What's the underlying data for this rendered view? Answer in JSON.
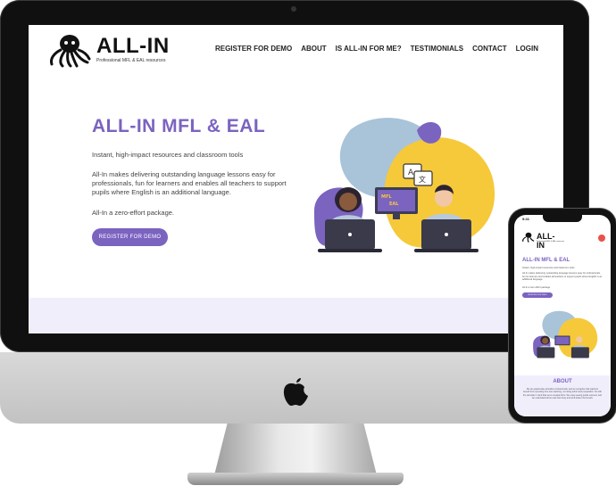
{
  "site": {
    "logo_text": "ALL-IN",
    "logo_sub": "Professional MFL & EAL resources",
    "nav": [
      {
        "label": "REGISTER FOR DEMO"
      },
      {
        "label": "ABOUT"
      },
      {
        "label": "IS ALL-IN FOR ME?"
      },
      {
        "label": "TESTIMONIALS"
      },
      {
        "label": "CONTACT"
      },
      {
        "label": "LOGIN"
      }
    ],
    "hero": {
      "title": "ALL-IN MFL & EAL",
      "p1": "Instant, high-impact resources and classroom tools",
      "p2": "All-In makes delivering outstanding language lessons easy for professionals, fun for learners and enables all teachers to support pupils where English is an additional language.",
      "p3": "All-In a zero-effort package.",
      "button": "REGISTER FOR DEMO"
    },
    "illustration": {
      "screen_text_1": "MFL",
      "screen_text_2": "EAL"
    }
  },
  "phone": {
    "time": "9:41",
    "logo_text": "ALL-IN",
    "logo_sub": "Professional MFL & EAL resources",
    "title": "ALL-IN MFL & EAL",
    "p1": "Instant, high-impact resources and classroom tools",
    "p2": "All-In makes delivering outstanding language lessons easy for professionals, fun for learners and enables all teachers to support pupils where English is an additional language.",
    "p3": "All-In a zero-effort package.",
    "button": "REGISTER FOR DEMO",
    "about_title": "ABOUT",
    "about_text": "We are passionate education professionals, and we recognise that teachers benefit from spending time less teaching, not doing admin and preparation. So with the principle in mind that we've created All-In. We enjoy seeing pupils succeed, and we understand all too well how busy and we'll deliver the benefit."
  },
  "colors": {
    "accent": "#7b63c0",
    "blob_blue": "#a9c3d9",
    "blob_yellow": "#f5c93a",
    "blob_purple": "#7b63c0",
    "band": "#f1eefc"
  },
  "icons": {
    "logo": "octopus-icon",
    "hardware": "apple-logo-icon",
    "phone_menu": "menu-icon"
  }
}
